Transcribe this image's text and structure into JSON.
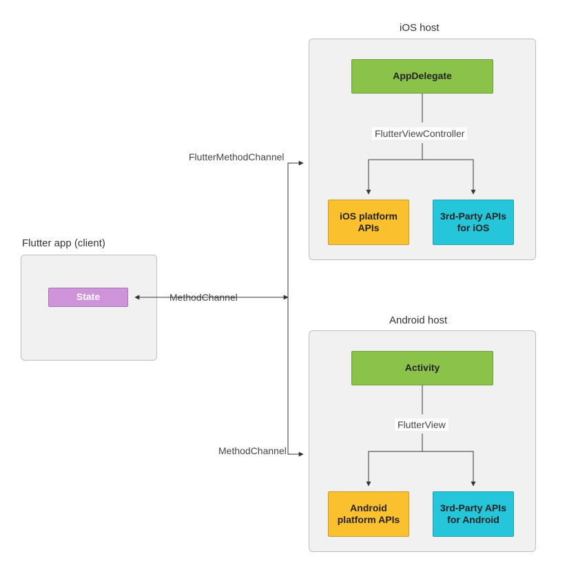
{
  "flutter_client": {
    "title": "Flutter app (client)",
    "state": "State"
  },
  "ios": {
    "title": "iOS host",
    "app_delegate": "AppDelegate",
    "view_controller": "FlutterViewController",
    "platform_apis": "iOS platform APIs",
    "third_party": "3rd-Party APIs for iOS"
  },
  "android": {
    "title": "Android host",
    "activity": "Activity",
    "flutter_view": "FlutterView",
    "platform_apis": "Android platform APIs",
    "third_party": "3rd-Party APIs for Android"
  },
  "edges": {
    "method_channel": "MethodChannel",
    "flutter_method_channel": "FlutterMethodChannel",
    "android_method_channel": "MethodChannel"
  },
  "colors": {
    "green": "#8bc34a",
    "purple": "#ce93d8",
    "orange": "#fbc02d",
    "cyan": "#26c6da",
    "container_bg": "#f1f1f1",
    "container_border": "#bdbdbd"
  }
}
